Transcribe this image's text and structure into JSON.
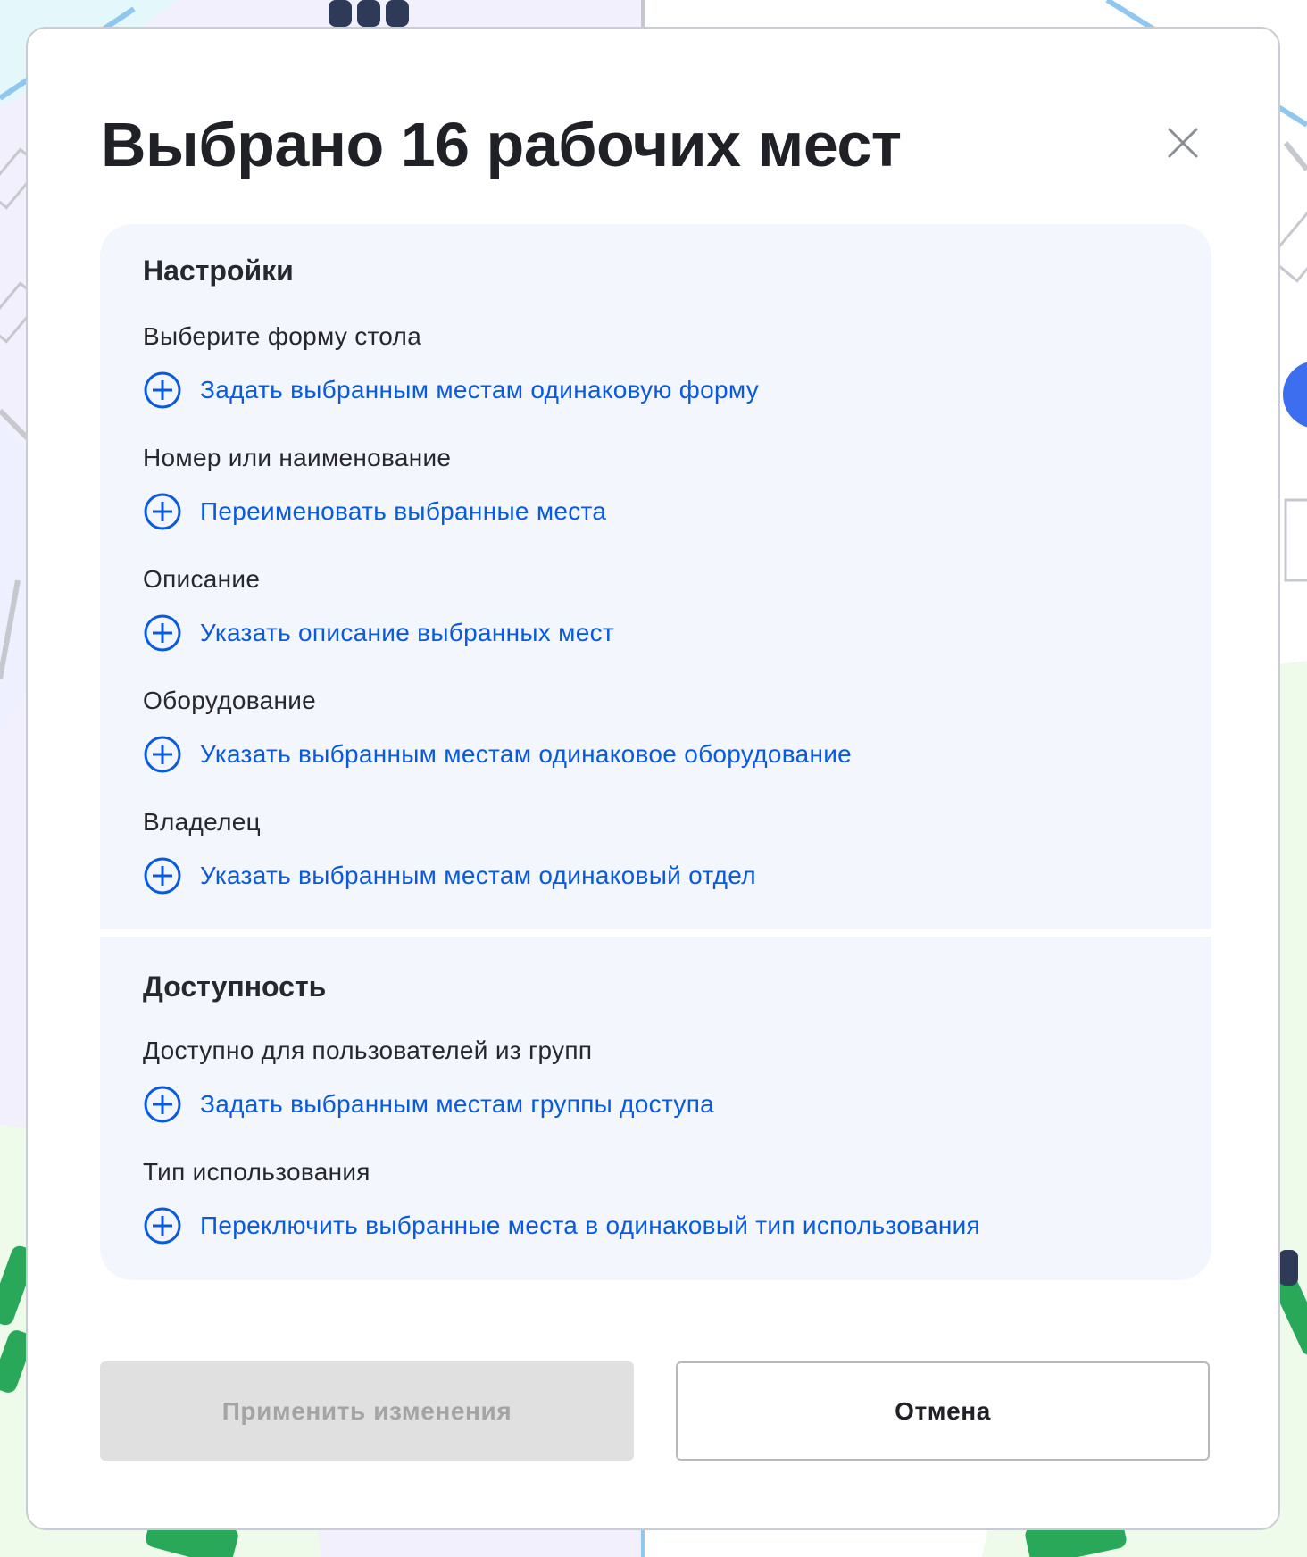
{
  "dialog": {
    "title": "Выбрано 16 рабочих мест"
  },
  "settings": {
    "heading": "Настройки",
    "fields": [
      {
        "label": "Выберите форму стола",
        "action": "Задать выбранным местам одинаковую форму"
      },
      {
        "label": "Номер или наименование",
        "action": "Переименовать выбранные места"
      },
      {
        "label": "Описание",
        "action": "Указать описание выбранных мест"
      },
      {
        "label": "Оборудование",
        "action": "Указать выбранным местам одинаковое оборудование"
      },
      {
        "label": "Владелец",
        "action": "Указать выбранным местам одинаковый отдел"
      }
    ]
  },
  "access": {
    "heading": "Доступность",
    "fields": [
      {
        "label": "Доступно для пользователей из групп",
        "action": "Задать выбранным местам группы доступа"
      },
      {
        "label": "Тип использования",
        "action": "Переключить выбранные места в одинаковый тип использования"
      }
    ]
  },
  "footer": {
    "apply_label": "Применить изменения",
    "cancel_label": "Отмена"
  },
  "icons": {
    "close": "close-icon",
    "add": "plus-circle-icon"
  },
  "colors": {
    "accent": "#0a5ae0",
    "panel_bg": "#f3f6fc",
    "disabled_bg": "#e0e0e0",
    "disabled_text": "#a4a4a4",
    "floor_green": "#2aa85a",
    "floor_navy": "#2e3a57"
  }
}
